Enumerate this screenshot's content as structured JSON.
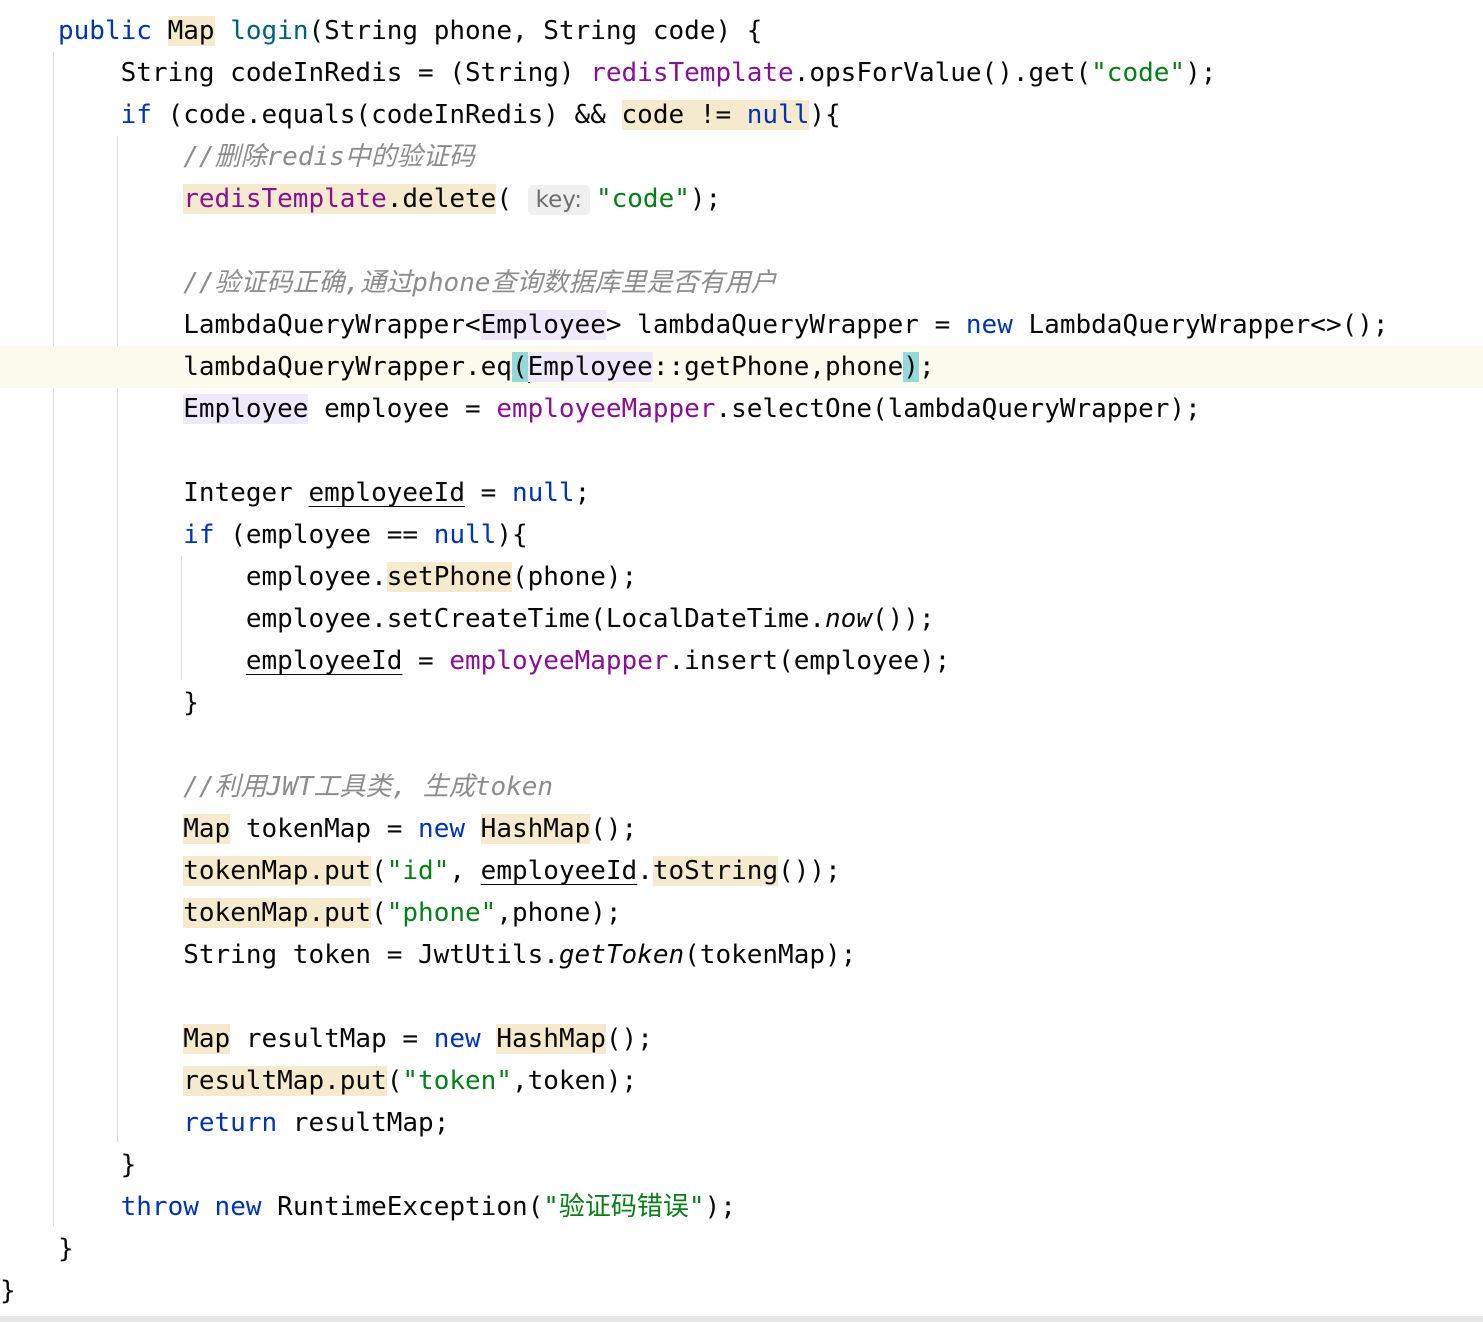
{
  "code": {
    "lines": [
      [
        [
          "kw",
          "public"
        ],
        [
          "t",
          " "
        ],
        [
          "hl",
          "Map"
        ],
        [
          "t",
          " "
        ],
        [
          "fn",
          "login"
        ],
        [
          "t",
          "(String phone, String code) {"
        ]
      ],
      [
        [
          "t",
          "    String codeInRedis = (String) "
        ],
        [
          "fld",
          "redisTemplate"
        ],
        [
          "t",
          ".opsForValue().get("
        ],
        [
          "str",
          "\"code\""
        ],
        [
          "t",
          ");"
        ]
      ],
      [
        [
          "kw",
          "    if"
        ],
        [
          "t",
          " (code.equals(codeInRedis) && "
        ],
        [
          "hl",
          "code != "
        ],
        [
          "kwhl",
          "null"
        ],
        [
          "t",
          "){"
        ]
      ],
      [
        [
          "cmt",
          "        //删除redis中的验证码"
        ]
      ],
      [
        [
          "t",
          "        "
        ],
        [
          "hlfld",
          "redisTemplate"
        ],
        [
          "hl",
          ".delete"
        ],
        [
          "t",
          "( "
        ],
        [
          "hint",
          "key:"
        ],
        [
          "str",
          "\"code\""
        ],
        [
          "t",
          ");"
        ]
      ],
      [
        [
          "t",
          ""
        ]
      ],
      [
        [
          "cmt",
          "        //验证码正确,通过phone查询数据库里是否有用户"
        ]
      ],
      [
        [
          "t",
          "        LambdaQueryWrapper<"
        ],
        [
          "hlp",
          "Employee"
        ],
        [
          "t",
          "> lambdaQueryWrapper = "
        ],
        [
          "kw",
          "new"
        ],
        [
          "t",
          " LambdaQueryWrapper<>();"
        ]
      ],
      [
        [
          "t",
          "        lambdaQueryWrapper.eq"
        ],
        [
          "brk",
          "("
        ],
        [
          "caret",
          ""
        ],
        [
          "hlp",
          "Employee"
        ],
        [
          "t",
          "::getPhone,phone"
        ],
        [
          "brk",
          ")"
        ],
        [
          "t",
          ";"
        ]
      ],
      [
        [
          "t",
          "        "
        ],
        [
          "hlp",
          "Employee"
        ],
        [
          "t",
          " employee = "
        ],
        [
          "fld",
          "employeeMapper"
        ],
        [
          "t",
          ".selectOne(lambdaQueryWrapper);"
        ]
      ],
      [
        [
          "t",
          ""
        ]
      ],
      [
        [
          "t",
          "        Integer "
        ],
        [
          "ul",
          "employeeId"
        ],
        [
          "t",
          " = "
        ],
        [
          "kw",
          "null"
        ],
        [
          "t",
          ";"
        ]
      ],
      [
        [
          "kw",
          "        if"
        ],
        [
          "t",
          " (employee == "
        ],
        [
          "kw",
          "null"
        ],
        [
          "t",
          "){"
        ]
      ],
      [
        [
          "t",
          "            employee."
        ],
        [
          "hl",
          "setPhone"
        ],
        [
          "t",
          "(phone);"
        ]
      ],
      [
        [
          "t",
          "            employee.setCreateTime(LocalDateTime."
        ],
        [
          "it",
          "now"
        ],
        [
          "t",
          "());"
        ]
      ],
      [
        [
          "t",
          "            "
        ],
        [
          "ul",
          "employeeId"
        ],
        [
          "t",
          " = "
        ],
        [
          "fld",
          "employeeMapper"
        ],
        [
          "t",
          ".insert(employee);"
        ]
      ],
      [
        [
          "t",
          "        }"
        ]
      ],
      [
        [
          "t",
          ""
        ]
      ],
      [
        [
          "cmt",
          "        //利用JWT工具类, 生成token"
        ]
      ],
      [
        [
          "t",
          "        "
        ],
        [
          "hl",
          "Map"
        ],
        [
          "t",
          " tokenMap = "
        ],
        [
          "kw",
          "new"
        ],
        [
          "t",
          " "
        ],
        [
          "hl",
          "HashMap"
        ],
        [
          "t",
          "();"
        ]
      ],
      [
        [
          "t",
          "        "
        ],
        [
          "hl",
          "tokenMap.put"
        ],
        [
          "t",
          "("
        ],
        [
          "str",
          "\"id\""
        ],
        [
          "t",
          ", "
        ],
        [
          "ul",
          "employeeId"
        ],
        [
          "t",
          "."
        ],
        [
          "hl",
          "toString"
        ],
        [
          "t",
          "());"
        ]
      ],
      [
        [
          "t",
          "        "
        ],
        [
          "hl",
          "tokenMap.put"
        ],
        [
          "t",
          "("
        ],
        [
          "str",
          "\"phone\""
        ],
        [
          "t",
          ",phone);"
        ]
      ],
      [
        [
          "t",
          "        String token = JwtUtils."
        ],
        [
          "it",
          "getToken"
        ],
        [
          "t",
          "(tokenMap);"
        ]
      ],
      [
        [
          "t",
          ""
        ]
      ],
      [
        [
          "t",
          "        "
        ],
        [
          "hl",
          "Map"
        ],
        [
          "t",
          " resultMap = "
        ],
        [
          "kw",
          "new"
        ],
        [
          "t",
          " "
        ],
        [
          "hl",
          "HashMap"
        ],
        [
          "t",
          "();"
        ]
      ],
      [
        [
          "t",
          "        "
        ],
        [
          "hl",
          "resultMap.put"
        ],
        [
          "t",
          "("
        ],
        [
          "str",
          "\"token\""
        ],
        [
          "t",
          ",token);"
        ]
      ],
      [
        [
          "kw",
          "        return"
        ],
        [
          "t",
          " resultMap;"
        ]
      ],
      [
        [
          "t",
          "    }"
        ]
      ],
      [
        [
          "kw",
          "    throw"
        ],
        [
          "t",
          " "
        ],
        [
          "kw",
          "new"
        ],
        [
          "t",
          " RuntimeException("
        ],
        [
          "str",
          "\"验证码错误\""
        ],
        [
          "t",
          ");"
        ]
      ],
      [
        [
          "t",
          "}"
        ]
      ],
      [
        [
          "t",
          "}"
        ]
      ]
    ]
  },
  "colors": {
    "keyword": "#0033b3",
    "field": "#871094",
    "string": "#067d17",
    "comment": "#8c8c8c",
    "method": "#00627a",
    "highlight": "#f5eacd",
    "type_highlight": "#ede9fb",
    "brace_match": "#93d9d9",
    "current_line": "#fcfaed"
  }
}
